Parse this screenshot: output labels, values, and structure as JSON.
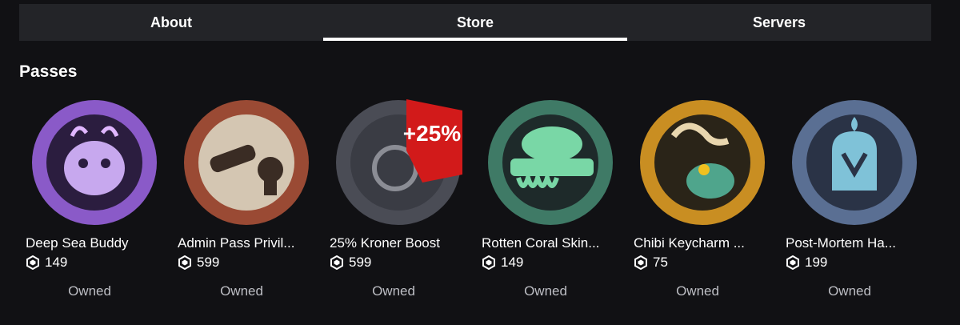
{
  "tabs": [
    {
      "label": "About",
      "active": false
    },
    {
      "label": "Store",
      "active": true
    },
    {
      "label": "Servers",
      "active": false
    }
  ],
  "section_title": "Passes",
  "passes": [
    {
      "name": "Deep Sea Buddy",
      "price": "149",
      "status": "Owned",
      "icon": "deep-sea-buddy-badge",
      "ring_color": "#8a5ac8",
      "inner_color": "#c7a8ee"
    },
    {
      "name": "Admin Pass Privil...",
      "price": "599",
      "status": "Owned",
      "icon": "admin-pass-badge",
      "ring_color": "#9a4a34",
      "inner_color": "#d4c6b2"
    },
    {
      "name": "25% Kroner Boost",
      "price": "599",
      "status": "Owned",
      "icon": "kroner-boost-badge",
      "ring_color": "#4a4c55",
      "inner_color": "#3a3c44",
      "badge_text": "+25%",
      "badge_color": "#d21a1a"
    },
    {
      "name": "Rotten Coral Skin...",
      "price": "149",
      "status": "Owned",
      "icon": "rotten-coral-skin-badge",
      "ring_color": "#3f7a66",
      "inner_color": "#79d7a6"
    },
    {
      "name": "Chibi Keycharm ...",
      "price": "75",
      "status": "Owned",
      "icon": "chibi-keycharm-badge",
      "ring_color": "#c98e22",
      "inner_color": "#e8d6ae"
    },
    {
      "name": "Post-Mortem Ha...",
      "price": "199",
      "status": "Owned",
      "icon": "post-mortem-badge",
      "ring_color": "#5a6f93",
      "inner_color": "#7fc2d8"
    }
  ]
}
